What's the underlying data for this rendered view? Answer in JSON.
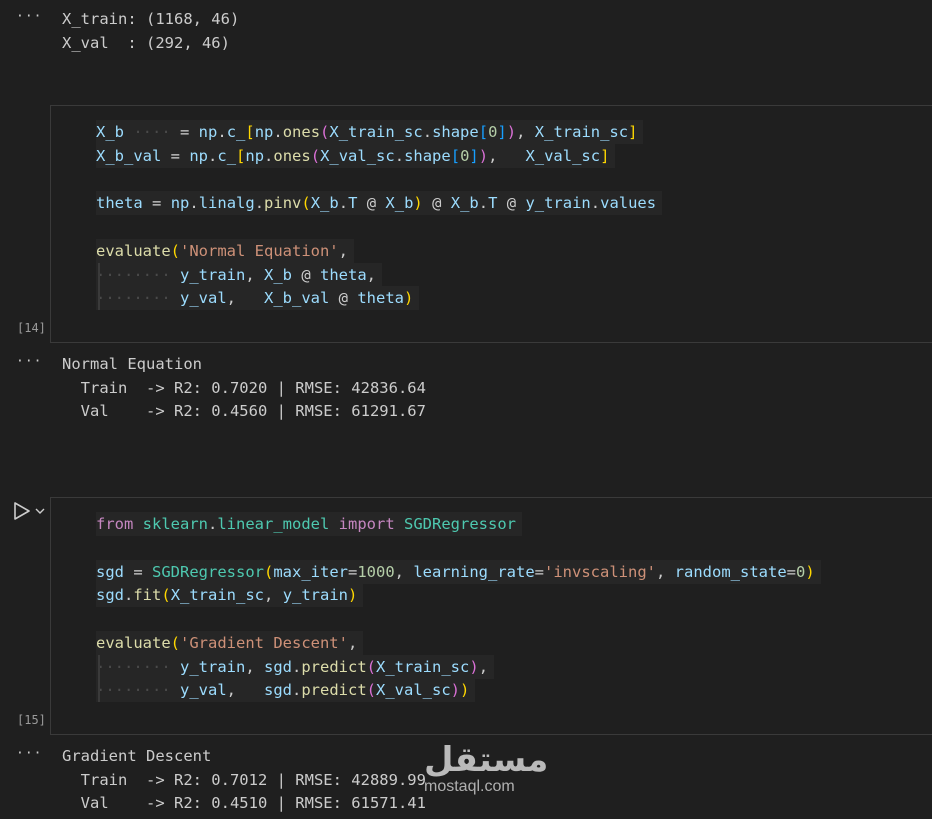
{
  "output1": {
    "menu_icon": "ellipsis-icon",
    "lines": [
      "X_train: (1168, 46)",
      "X_val  : (292, 46)"
    ]
  },
  "cell14": {
    "exec_count": "[14]",
    "code": [
      "X_b     = np.c_[np.ones(X_train_sc.shape[0]), X_train_sc]",
      "X_b_val = np.c_[np.ones(X_val_sc.shape[0]),   X_val_sc]",
      "",
      "theta = np.linalg.pinv(X_b.T @ X_b) @ X_b.T @ y_train.values",
      "",
      "evaluate('Normal Equation',",
      "         y_train, X_b @ theta,",
      "         y_val,   X_b_val @ theta)"
    ]
  },
  "output2": {
    "title": "Normal Equation",
    "lines": [
      "  Train  -> R2: 0.7020 | RMSE: 42836.64",
      "  Val    -> R2: 0.4560 | RMSE: 61291.67"
    ]
  },
  "cell15": {
    "exec_count": "[15]",
    "run_icon": "play-icon",
    "chevron_icon": "chevron-down-icon",
    "code": [
      "from sklearn.linear_model import SGDRegressor",
      "",
      "sgd = SGDRegressor(max_iter=1000, learning_rate='invscaling', random_state=0)",
      "sgd.fit(X_train_sc, y_train)",
      "",
      "evaluate('Gradient Descent',",
      "         y_train, sgd.predict(X_train_sc),",
      "         y_val,   sgd.predict(X_val_sc))"
    ]
  },
  "output3": {
    "title": "Gradient Descent",
    "lines": [
      "  Train  -> R2: 0.7012 | RMSE: 42889.99",
      "  Val    -> R2: 0.4510 | RMSE: 61571.41"
    ]
  },
  "watermark": {
    "arabic": "مستقل",
    "latin": "mostaql.com"
  },
  "colors": {
    "background": "#1f1f1f",
    "variable": "#9cdcfe",
    "function": "#dcdcaa",
    "string": "#ce9178",
    "number": "#b5cea8",
    "keyword": "#c586c0"
  }
}
